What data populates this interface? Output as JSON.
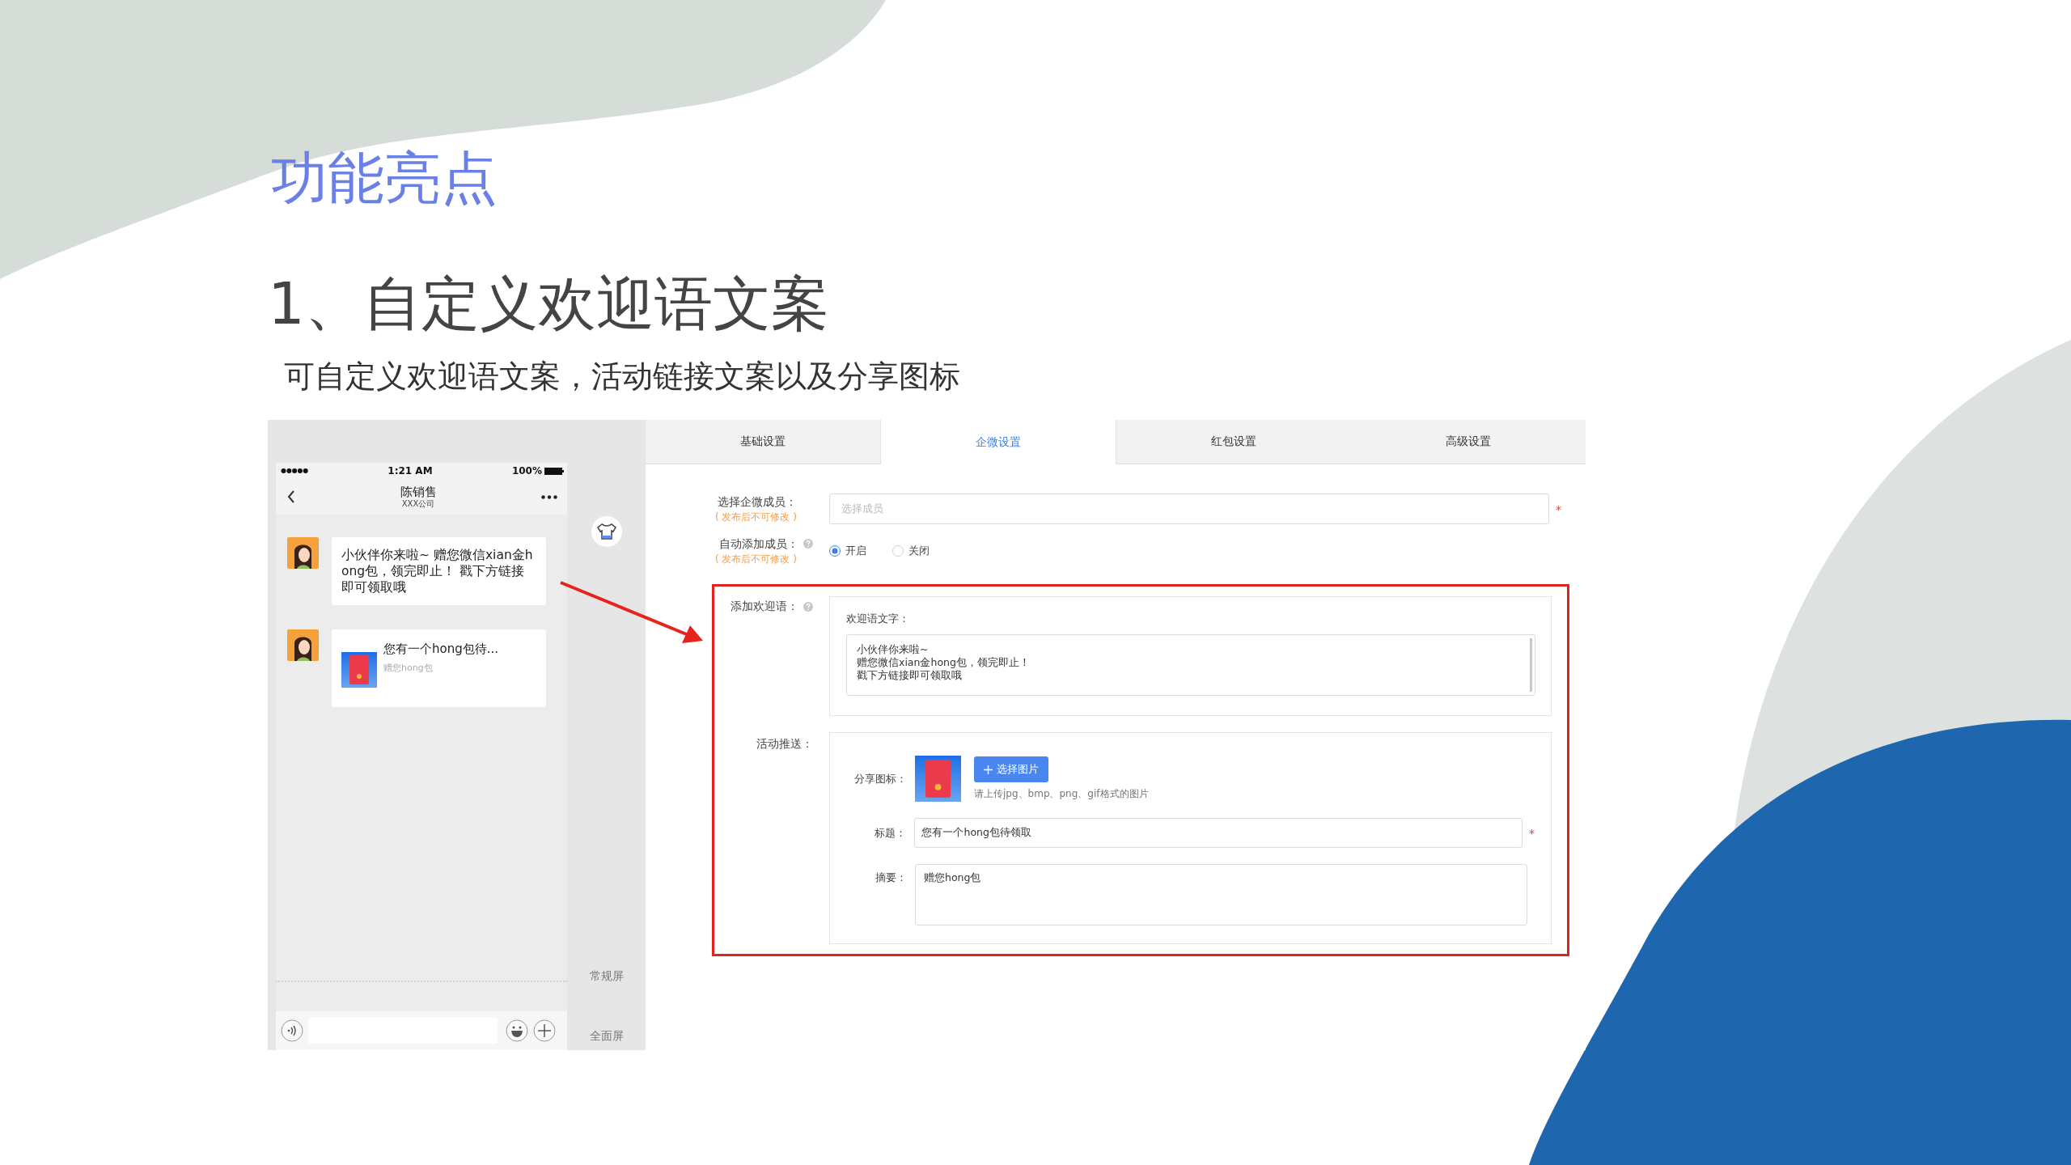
{
  "slide": {
    "title": "功能亮点",
    "heading": "1、自定义欢迎语文案",
    "subtitle": "可自定义欢迎语文案，活动链接文案以及分享图标"
  },
  "phone": {
    "time": "1:21 AM",
    "battery": "100%",
    "chat_title": "陈销售",
    "chat_subtitle": "XXX公司",
    "messages": [
      {
        "kind": "text",
        "text": "小伙伴你来啦~ 赠您微信xian金hong包，领完即止！ 戳下方链接即可领取哦"
      },
      {
        "kind": "card",
        "title": "您有一个hong包待...",
        "description": "赠您hong包"
      }
    ],
    "side_labels": [
      "常规屏",
      "全面屏"
    ]
  },
  "tabs": [
    {
      "label": "基础设置",
      "selected": false
    },
    {
      "label": "企微设置",
      "selected": true
    },
    {
      "label": "红包设置",
      "selected": false
    },
    {
      "label": "高级设置",
      "selected": false
    }
  ],
  "form": {
    "member": {
      "label": "选择企微成员：",
      "note": "( 发布后不可修改 )",
      "placeholder": "选择成员",
      "required_mark": "*"
    },
    "auto_add": {
      "label": "自动添加成员：",
      "note": "( 发布后不可修改 )",
      "options": [
        {
          "label": "开启",
          "selected": true
        },
        {
          "label": "关闭",
          "selected": false
        }
      ]
    },
    "welcome": {
      "label": "添加欢迎语：",
      "text_label": "欢迎语文字：",
      "lines": [
        "小伙伴你来啦~",
        "赠您微信xian金hong包，领完即止！",
        "戳下方链接即可领取哦"
      ]
    },
    "push": {
      "label": "活动推送：",
      "icon_label": "分享图标：",
      "upload_button": "选择图片",
      "hint": "请上传jpg、bmp、png、gif格式的图片",
      "title_label": "标题：",
      "title_value": "您有一个hong包待领取",
      "title_required_mark": "*",
      "summary_label": "摘要：",
      "summary_value": "赠您hong包"
    }
  }
}
